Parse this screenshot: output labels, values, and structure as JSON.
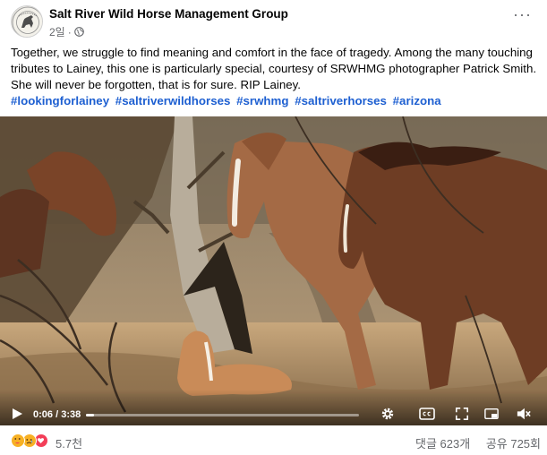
{
  "post": {
    "page_name": "Salt River Wild Horse Management Group",
    "time_ago": "2일",
    "separator": "·",
    "more_label": "···",
    "caption": "Together, we struggle to find meaning and comfort in the face of tragedy. Among the many touching tributes to Lainey, this one is particularly special, courtesy of SRWHMG photographer Patrick Smith. She will never be forgotten, that is for sure. RIP Lainey.",
    "hashtags": [
      "#lookingforlainey",
      "#saltriverwildhorses",
      "#srwhmg",
      "#saltriverhorses",
      "#arizona"
    ]
  },
  "video": {
    "current_time": "0:06",
    "duration": "3:38",
    "time_separator": " / ",
    "progress": 0.03
  },
  "footer": {
    "reaction_icons": [
      "care-icon",
      "sad-icon",
      "love-icon"
    ],
    "reaction_count": "5.7천",
    "comments": "댓글 623개",
    "shares": "공유 725회"
  },
  "colors": {
    "hashtag": "#1d5fd1",
    "secondary_text": "#65676b",
    "love": "#f33e58",
    "care": "#f7b125"
  }
}
